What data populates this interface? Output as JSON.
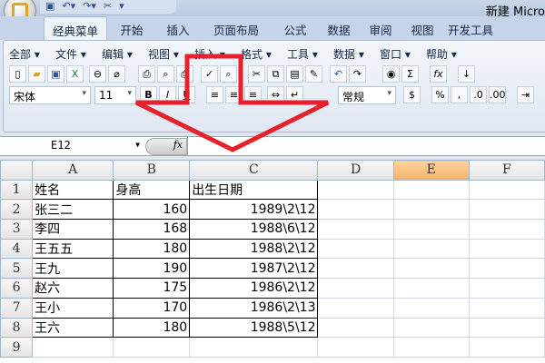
{
  "window": {
    "title": "新建 Micro"
  },
  "ribbon_tabs": [
    "经典菜单",
    "开始",
    "插入",
    "页面布局",
    "公式",
    "数据",
    "审阅",
    "视图",
    "开发工具"
  ],
  "menu": [
    "全部 ▾",
    "文件 ▾",
    "编辑 ▾",
    "视图 ▾",
    "插入 ▾",
    "格式 ▾",
    "工具 ▾",
    "数据 ▾",
    "窗口 ▾",
    "帮助 ▾"
  ],
  "font": {
    "name": "宋体",
    "size": "11",
    "bold": "B",
    "italic": "I",
    "underline": "U"
  },
  "number_format": "常规",
  "symbols": {
    "percent": "%",
    "comma": ",",
    "sum": "Σ",
    "fx": "fx"
  },
  "name_box": "E12",
  "columns": [
    "A",
    "B",
    "C",
    "D",
    "E",
    "F"
  ],
  "selected_column": "E",
  "rows": [
    {
      "n": "1",
      "a": "姓名",
      "b": "身高",
      "c": "出生日期"
    },
    {
      "n": "2",
      "a": "张三二",
      "b": "160",
      "c": "1989\\2\\12"
    },
    {
      "n": "3",
      "a": "李四",
      "b": "168",
      "c": "1988\\6\\12"
    },
    {
      "n": "4",
      "a": "王五五",
      "b": "180",
      "c": "1988\\2\\12"
    },
    {
      "n": "5",
      "a": "王九",
      "b": "190",
      "c": "1987\\2\\12"
    },
    {
      "n": "6",
      "a": "赵六",
      "b": "175",
      "c": "1986\\2\\12"
    },
    {
      "n": "7",
      "a": "王小",
      "b": "170",
      "c": "1986\\2\\13"
    },
    {
      "n": "8",
      "a": "王六",
      "b": "180",
      "c": "1988\\5\\12"
    },
    {
      "n": "9",
      "a": "",
      "b": "",
      "c": ""
    }
  ],
  "annotation_color": "#e8202a"
}
